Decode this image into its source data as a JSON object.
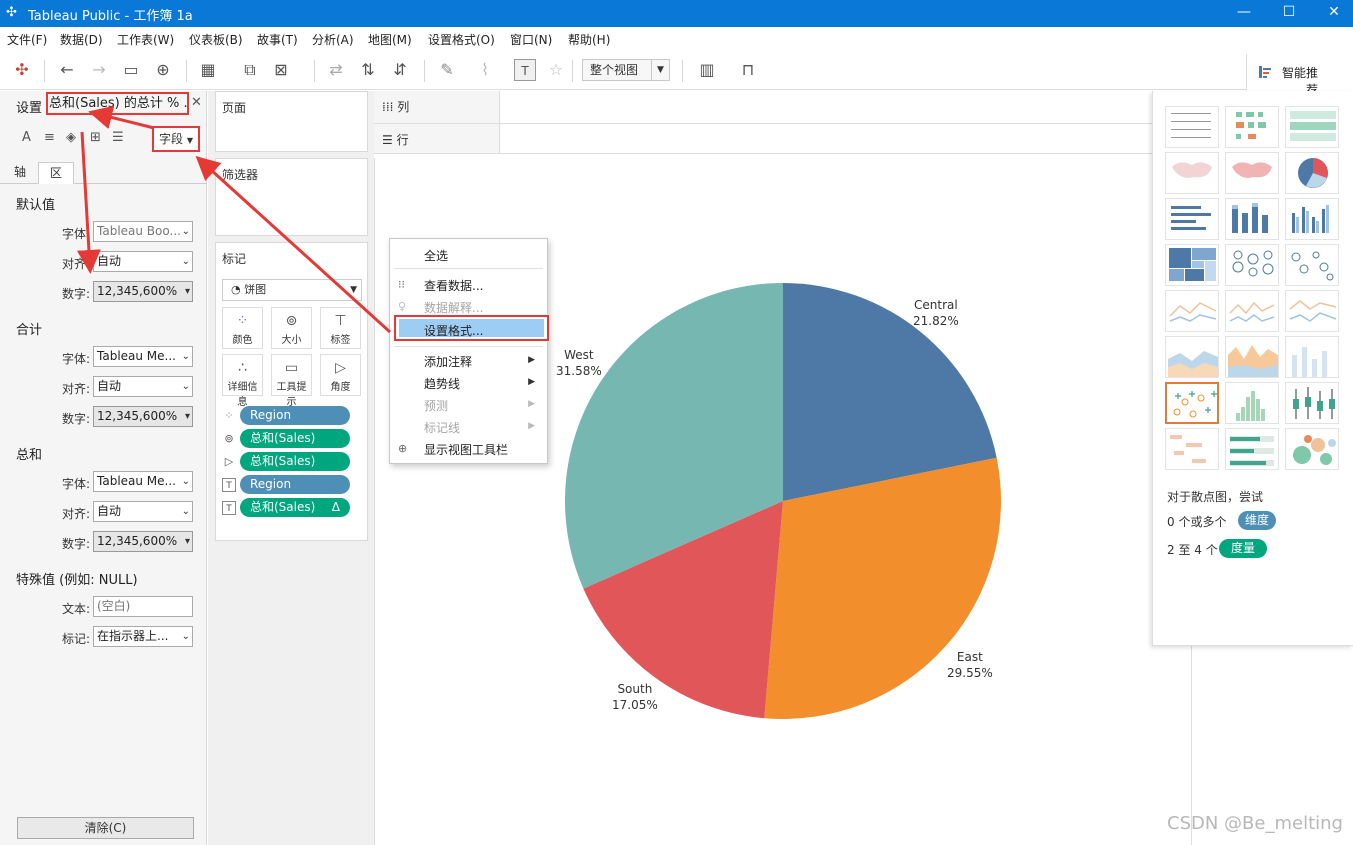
{
  "window": {
    "title": "Tableau Public - 工作簿 1a",
    "minimize": "—",
    "maximize": "☐",
    "close": "✕"
  },
  "menu": [
    "文件(F)",
    "数据(D)",
    "工作表(W)",
    "仪表板(B)",
    "故事(T)",
    "分析(A)",
    "地图(M)",
    "设置格式(O)",
    "窗口(N)",
    "帮助(H)"
  ],
  "toolbar": {
    "view_fit": "整个视图",
    "smart_tab": "智能推荐"
  },
  "format_pane": {
    "prefix": "设置",
    "title": "总和(Sales) 的总计 % ...",
    "fields_btn": "字段",
    "tabs": [
      "轴",
      "区"
    ],
    "sections": {
      "default": "默认值",
      "total": "合计",
      "grand": "总和",
      "special": "特殊值 (例如: NULL)"
    },
    "labels": {
      "font": "字体:",
      "align": "对齐:",
      "number": "数字:",
      "text": "文本:",
      "marks": "标记:"
    },
    "default_font": "Tableau Boo...",
    "total_font": "Tableau Me...",
    "grand_font": "Tableau Me...",
    "align_value": "自动",
    "number_value": "12,345,600%",
    "text_placeholder": "(空白)",
    "marks_value": "在指示器上...",
    "clear_btn": "清除(C)"
  },
  "shelves": {
    "pages": "页面",
    "filters": "筛选器",
    "marks": "标记",
    "mark_type": "饼图",
    "buttons": [
      "颜色",
      "大小",
      "标签",
      "详细信息",
      "工具提示",
      "角度"
    ],
    "pills": [
      {
        "name": "Region",
        "kind": "dim"
      },
      {
        "name": "总和(Sales)",
        "kind": "meas"
      },
      {
        "name": "总和(Sales)",
        "kind": "meas"
      },
      {
        "name": "Region",
        "kind": "dim"
      },
      {
        "name": "总和(Sales)",
        "kind": "meas"
      }
    ],
    "columns": "列",
    "rows": "行",
    "delta": "Δ"
  },
  "chart_data": {
    "type": "pie",
    "categories": [
      "Central",
      "East",
      "South",
      "West"
    ],
    "values": [
      21.82,
      29.55,
      17.05,
      31.58
    ],
    "value_labels": [
      "21.82%",
      "29.55%",
      "17.05%",
      "31.58%"
    ],
    "colors": [
      "#4e79a7",
      "#f28e2b",
      "#e15759",
      "#76b7b2"
    ]
  },
  "context_menu": {
    "items": [
      "全选",
      "查看数据...",
      "数据解释...",
      "设置格式...",
      "添加注释",
      "趋势线",
      "预测",
      "标记线",
      "显示视图工具栏"
    ]
  },
  "smart_pane": {
    "hint": "对于散点图，尝试",
    "dims_pre": "0 个或多个",
    "dims_badge": "维度",
    "meas_pre": "2 至 4 个",
    "meas_badge": "度量"
  },
  "watermark": "CSDN @Be_melting",
  "accent": {
    "red": "#e53935",
    "blue_title": "#0a78d7",
    "dim_pill": "#4e8fb7",
    "meas_pill": "#00a67e"
  }
}
